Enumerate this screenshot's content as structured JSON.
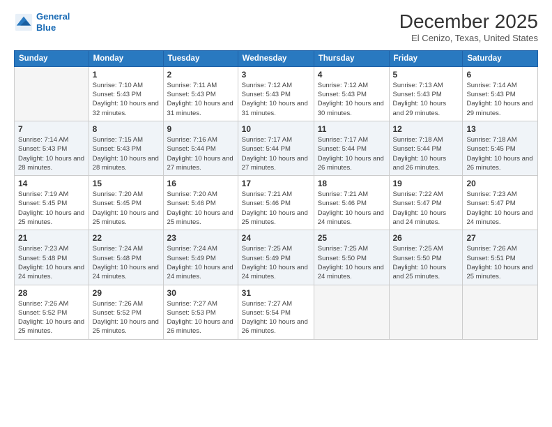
{
  "header": {
    "logo_line1": "General",
    "logo_line2": "Blue",
    "month": "December 2025",
    "location": "El Cenizo, Texas, United States"
  },
  "days_of_week": [
    "Sunday",
    "Monday",
    "Tuesday",
    "Wednesday",
    "Thursday",
    "Friday",
    "Saturday"
  ],
  "weeks": [
    [
      {
        "num": "",
        "empty": true
      },
      {
        "num": "1",
        "sunrise": "7:10 AM",
        "sunset": "5:43 PM",
        "daylight": "10 hours and 32 minutes."
      },
      {
        "num": "2",
        "sunrise": "7:11 AM",
        "sunset": "5:43 PM",
        "daylight": "10 hours and 31 minutes."
      },
      {
        "num": "3",
        "sunrise": "7:12 AM",
        "sunset": "5:43 PM",
        "daylight": "10 hours and 31 minutes."
      },
      {
        "num": "4",
        "sunrise": "7:12 AM",
        "sunset": "5:43 PM",
        "daylight": "10 hours and 30 minutes."
      },
      {
        "num": "5",
        "sunrise": "7:13 AM",
        "sunset": "5:43 PM",
        "daylight": "10 hours and 29 minutes."
      },
      {
        "num": "6",
        "sunrise": "7:14 AM",
        "sunset": "5:43 PM",
        "daylight": "10 hours and 29 minutes."
      }
    ],
    [
      {
        "num": "7",
        "sunrise": "7:14 AM",
        "sunset": "5:43 PM",
        "daylight": "10 hours and 28 minutes."
      },
      {
        "num": "8",
        "sunrise": "7:15 AM",
        "sunset": "5:43 PM",
        "daylight": "10 hours and 28 minutes."
      },
      {
        "num": "9",
        "sunrise": "7:16 AM",
        "sunset": "5:44 PM",
        "daylight": "10 hours and 27 minutes."
      },
      {
        "num": "10",
        "sunrise": "7:17 AM",
        "sunset": "5:44 PM",
        "daylight": "10 hours and 27 minutes."
      },
      {
        "num": "11",
        "sunrise": "7:17 AM",
        "sunset": "5:44 PM",
        "daylight": "10 hours and 26 minutes."
      },
      {
        "num": "12",
        "sunrise": "7:18 AM",
        "sunset": "5:44 PM",
        "daylight": "10 hours and 26 minutes."
      },
      {
        "num": "13",
        "sunrise": "7:18 AM",
        "sunset": "5:45 PM",
        "daylight": "10 hours and 26 minutes."
      }
    ],
    [
      {
        "num": "14",
        "sunrise": "7:19 AM",
        "sunset": "5:45 PM",
        "daylight": "10 hours and 25 minutes."
      },
      {
        "num": "15",
        "sunrise": "7:20 AM",
        "sunset": "5:45 PM",
        "daylight": "10 hours and 25 minutes."
      },
      {
        "num": "16",
        "sunrise": "7:20 AM",
        "sunset": "5:46 PM",
        "daylight": "10 hours and 25 minutes."
      },
      {
        "num": "17",
        "sunrise": "7:21 AM",
        "sunset": "5:46 PM",
        "daylight": "10 hours and 25 minutes."
      },
      {
        "num": "18",
        "sunrise": "7:21 AM",
        "sunset": "5:46 PM",
        "daylight": "10 hours and 24 minutes."
      },
      {
        "num": "19",
        "sunrise": "7:22 AM",
        "sunset": "5:47 PM",
        "daylight": "10 hours and 24 minutes."
      },
      {
        "num": "20",
        "sunrise": "7:23 AM",
        "sunset": "5:47 PM",
        "daylight": "10 hours and 24 minutes."
      }
    ],
    [
      {
        "num": "21",
        "sunrise": "7:23 AM",
        "sunset": "5:48 PM",
        "daylight": "10 hours and 24 minutes."
      },
      {
        "num": "22",
        "sunrise": "7:24 AM",
        "sunset": "5:48 PM",
        "daylight": "10 hours and 24 minutes."
      },
      {
        "num": "23",
        "sunrise": "7:24 AM",
        "sunset": "5:49 PM",
        "daylight": "10 hours and 24 minutes."
      },
      {
        "num": "24",
        "sunrise": "7:25 AM",
        "sunset": "5:49 PM",
        "daylight": "10 hours and 24 minutes."
      },
      {
        "num": "25",
        "sunrise": "7:25 AM",
        "sunset": "5:50 PM",
        "daylight": "10 hours and 24 minutes."
      },
      {
        "num": "26",
        "sunrise": "7:25 AM",
        "sunset": "5:50 PM",
        "daylight": "10 hours and 25 minutes."
      },
      {
        "num": "27",
        "sunrise": "7:26 AM",
        "sunset": "5:51 PM",
        "daylight": "10 hours and 25 minutes."
      }
    ],
    [
      {
        "num": "28",
        "sunrise": "7:26 AM",
        "sunset": "5:52 PM",
        "daylight": "10 hours and 25 minutes."
      },
      {
        "num": "29",
        "sunrise": "7:26 AM",
        "sunset": "5:52 PM",
        "daylight": "10 hours and 25 minutes."
      },
      {
        "num": "30",
        "sunrise": "7:27 AM",
        "sunset": "5:53 PM",
        "daylight": "10 hours and 26 minutes."
      },
      {
        "num": "31",
        "sunrise": "7:27 AM",
        "sunset": "5:54 PM",
        "daylight": "10 hours and 26 minutes."
      },
      {
        "num": "",
        "empty": true
      },
      {
        "num": "",
        "empty": true
      },
      {
        "num": "",
        "empty": true
      }
    ]
  ]
}
